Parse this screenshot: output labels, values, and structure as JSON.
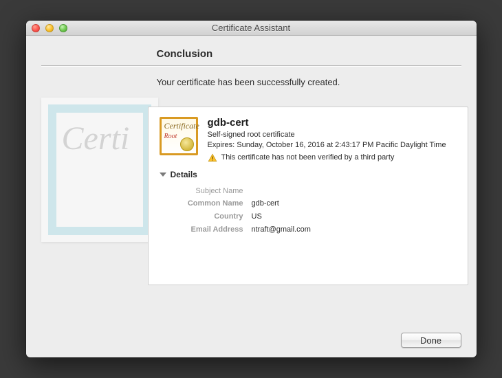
{
  "window": {
    "title": "Certificate Assistant"
  },
  "heading": "Conclusion",
  "message": "Your certificate has been successfully created.",
  "bg_script": "Certi",
  "cert": {
    "name": "gdb-cert",
    "type": "Self-signed root certificate",
    "expires": "Expires: Sunday, October 16, 2016 at 2:43:17 PM Pacific Daylight Time",
    "warn": "This certificate has not been verified by a third party",
    "icon_text": "Certificate",
    "icon_root": "Root"
  },
  "details": {
    "label": "Details",
    "section": "Subject Name",
    "rows": [
      {
        "k": "Common Name",
        "v": "gdb-cert"
      },
      {
        "k": "Country",
        "v": "US"
      },
      {
        "k": "Email Address",
        "v": "ntraft@gmail.com"
      }
    ]
  },
  "buttons": {
    "done": "Done"
  }
}
